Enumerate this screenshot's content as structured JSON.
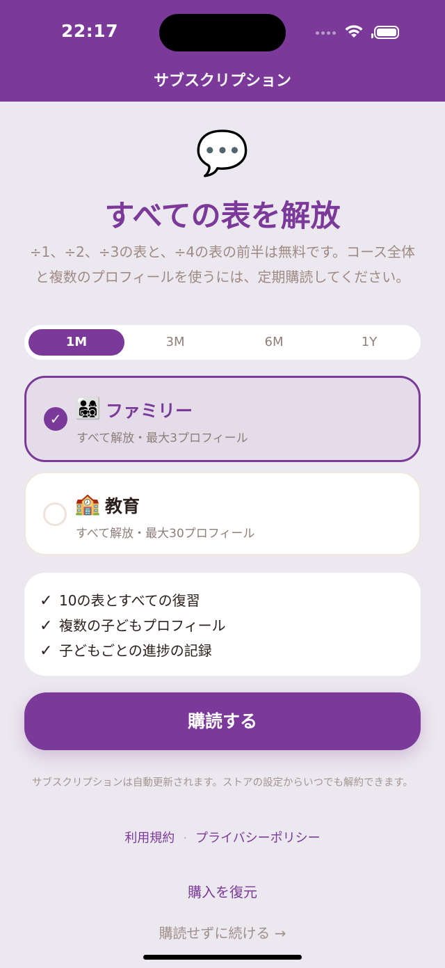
{
  "status_bar": {
    "time": "22:17"
  },
  "nav": {
    "title": "サブスクリプション"
  },
  "hero": {
    "icon": "💬",
    "title": "すべての表を解放",
    "subtitle": "÷1、÷2、÷3の表と、÷4の表の前半は無料です。コース全体と複数のプロフィールを使うには、定期購読してください。"
  },
  "periods": [
    {
      "label": "1M",
      "selected": true
    },
    {
      "label": "3M",
      "selected": false
    },
    {
      "label": "6M",
      "selected": false
    },
    {
      "label": "1Y",
      "selected": false
    }
  ],
  "plans": [
    {
      "icon": "👨‍👩‍👧‍👦",
      "name": "ファミリー",
      "desc": "すべて解放・最大3プロフィール",
      "selected": true,
      "check": "✓"
    },
    {
      "icon": "🏫",
      "name": "教育",
      "desc": "すべて解放・最大30プロフィール",
      "selected": false
    }
  ],
  "features": {
    "check": "✓",
    "items": [
      "10の表とすべての復習",
      "複数の子どもプロフィール",
      "子どもごとの進捗の記録"
    ]
  },
  "subscribe_label": "購読する",
  "legal_text": "サブスクリプションは自動更新されます。ストアの設定からいつでも解約できます。",
  "links": {
    "terms": "利用規約",
    "separator": "·",
    "privacy": "プライバシーポリシー"
  },
  "restore_label": "購入を復元",
  "skip_label": "購読せずに続ける →",
  "colors": {
    "accent": "#7B3A99",
    "background": "#ECE8EF",
    "muted_text": "#A08A84"
  }
}
